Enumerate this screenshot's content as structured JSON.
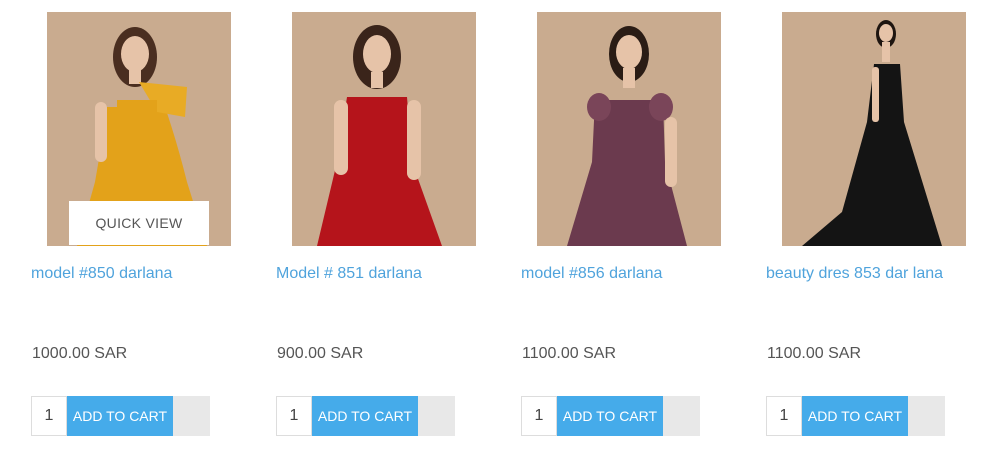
{
  "products": [
    {
      "name": "model #850 darlana",
      "price": "1000.00 SAR",
      "quantity": "1",
      "quick_view_label": "QUICK VIEW",
      "add_to_cart_label": "ADD TO CART",
      "dress_color": "#e3a21a"
    },
    {
      "name": "Model # 851 darlana",
      "price": "900.00 SAR",
      "quantity": "1",
      "add_to_cart_label": "ADD TO CART",
      "dress_color": "#b5141b"
    },
    {
      "name": "model #856 darlana",
      "price": "1100.00 SAR",
      "quantity": "1",
      "add_to_cart_label": "ADD TO CART",
      "dress_color": "#6b3a4e"
    },
    {
      "name": "beauty dres 853 dar lana",
      "price": "1100.00 SAR",
      "quantity": "1",
      "add_to_cart_label": "ADD TO CART",
      "dress_color": "#141414"
    }
  ],
  "colors": {
    "link": "#4fa3dc",
    "button": "#45abea",
    "background_photo": "#c9ab8f"
  }
}
